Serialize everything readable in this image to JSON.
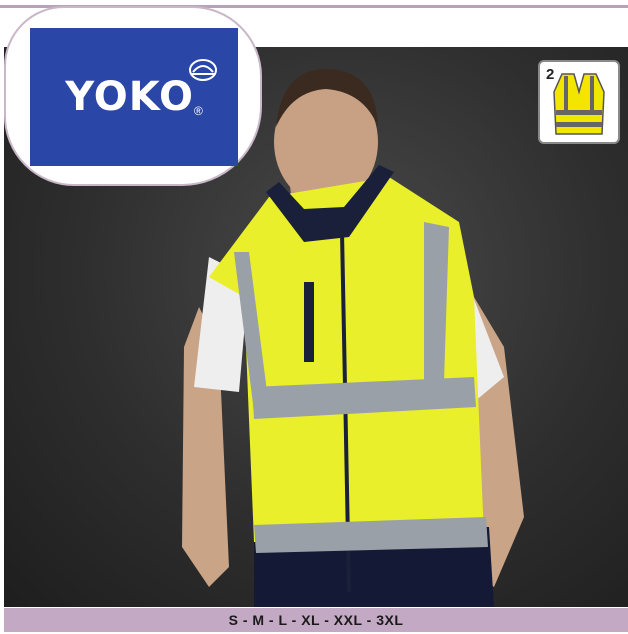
{
  "brand": {
    "logo_text": "YOKO",
    "registered_mark": "®",
    "logo_bg_color": "#2a46a6"
  },
  "safety_badge": {
    "class_number": "2",
    "icon": "hi-vis-vest-icon",
    "vest_color": "#f2e600"
  },
  "product_photo": {
    "subject": "hi-vis-fleece-bodywarmer",
    "vest_color": "#e9ef2a",
    "reflective_color": "#9aa0a8"
  },
  "sizes": {
    "label": "S - M - L - XL - XXL - 3XL"
  },
  "colors": {
    "divider": "#b9a3b8",
    "size_bar": "#c3a9c3"
  }
}
